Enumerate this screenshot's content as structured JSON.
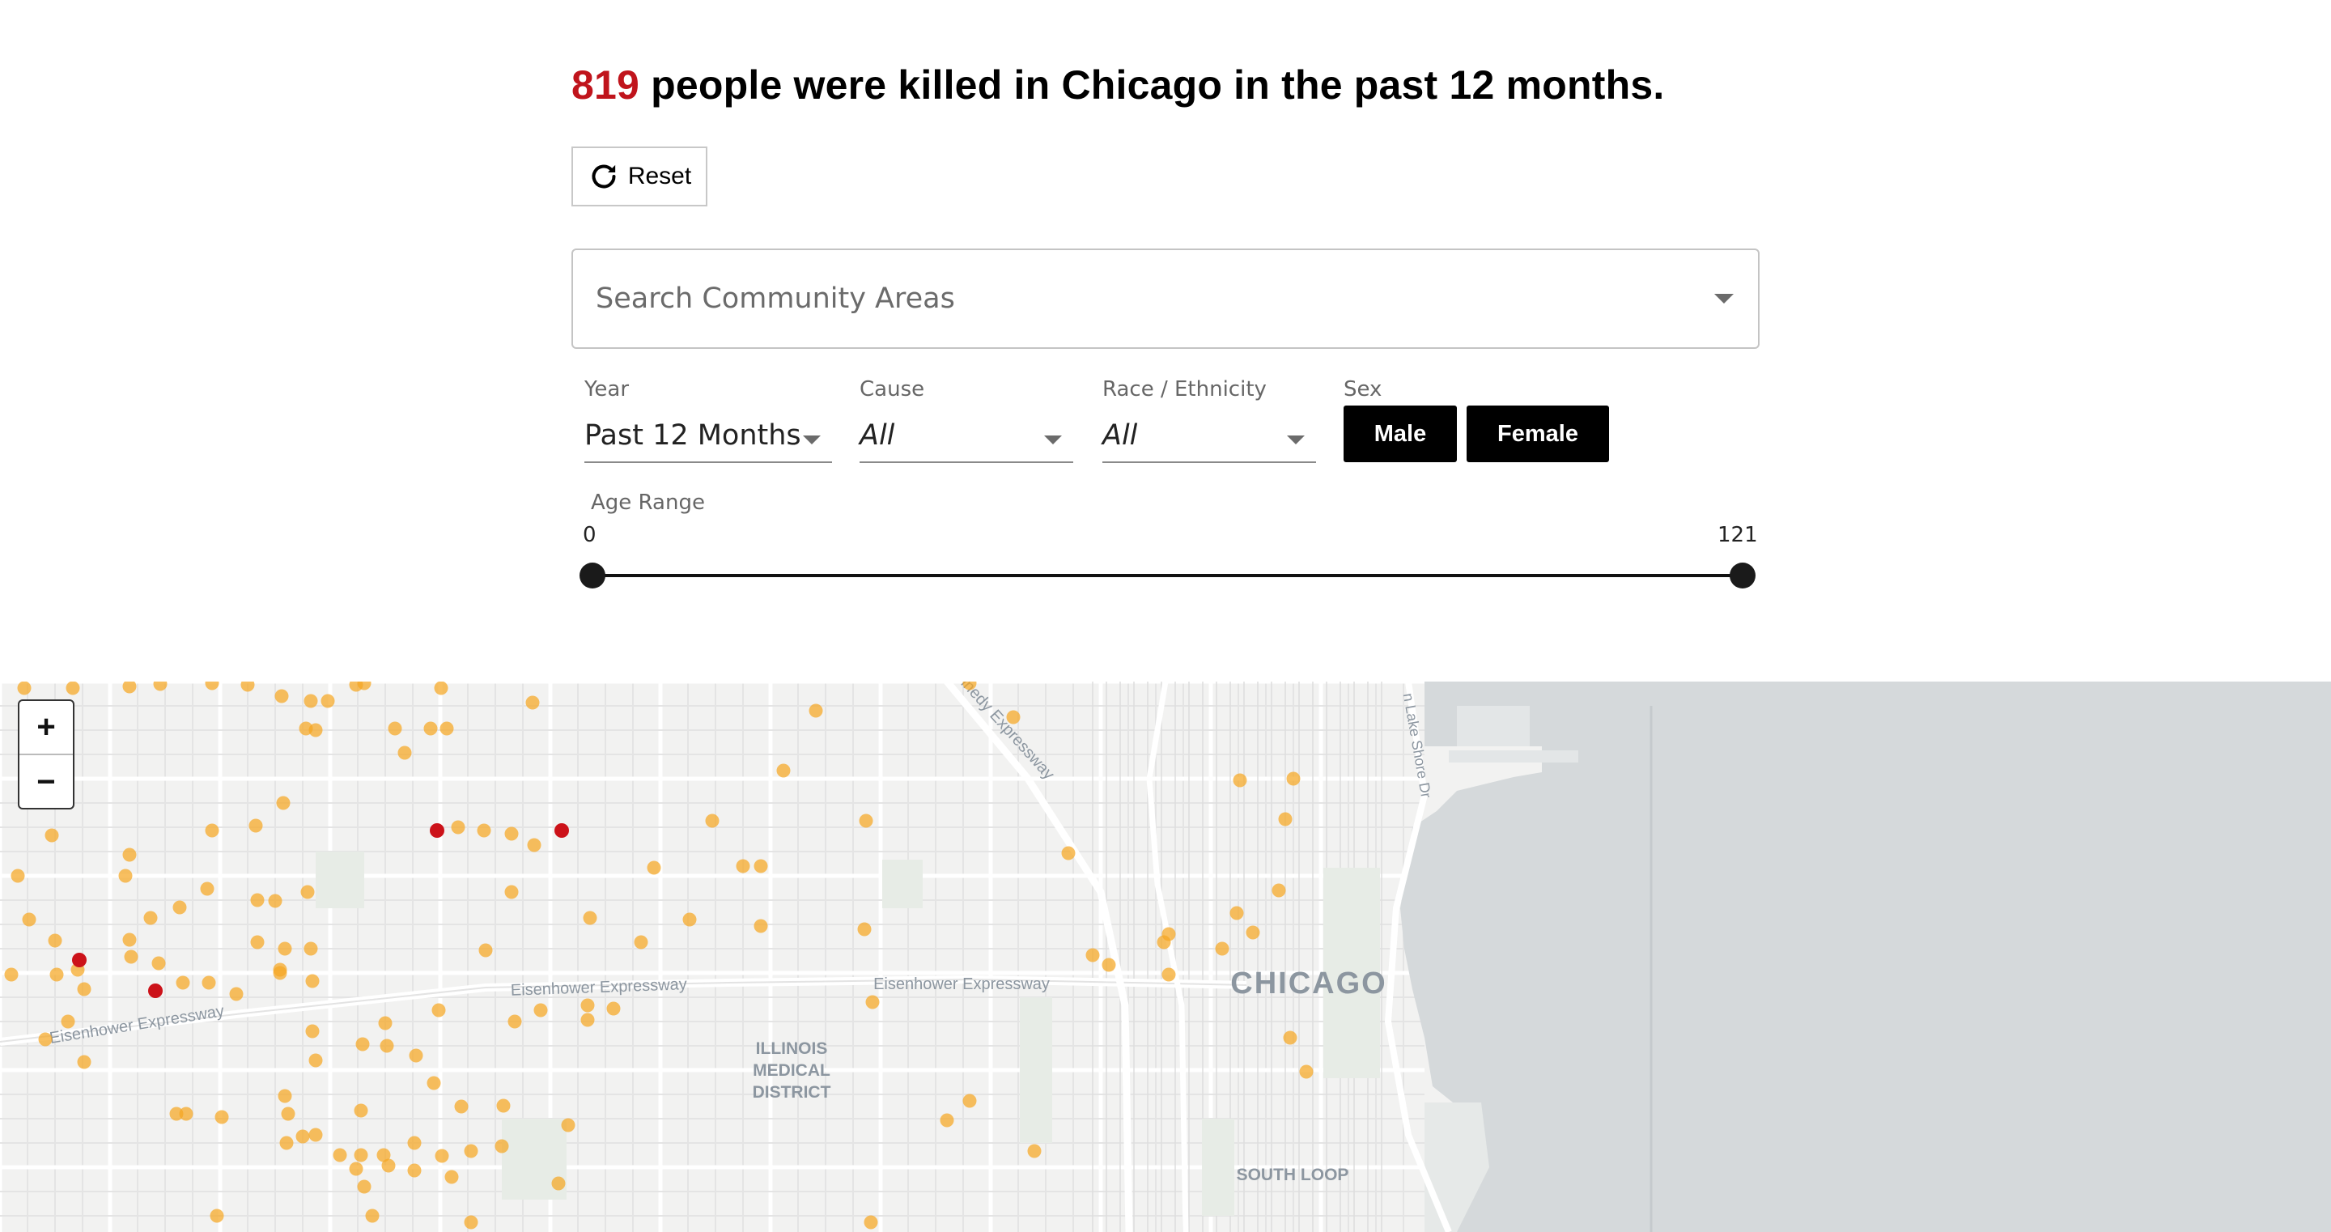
{
  "headline": {
    "count": "819",
    "text": " people were killed in Chicago in the past 12 months."
  },
  "controls": {
    "reset_label": "Reset",
    "search_placeholder": "Search Community Areas",
    "year": {
      "label": "Year",
      "value": "Past 12 Months"
    },
    "cause": {
      "label": "Cause",
      "value": "All"
    },
    "race": {
      "label": "Race / Ethnicity",
      "value": "All"
    },
    "sex": {
      "label": "Sex",
      "options": [
        "Male",
        "Female"
      ]
    },
    "age": {
      "label": "Age Range",
      "min": "0",
      "max": "121"
    }
  },
  "map": {
    "labels": {
      "city": "CHICAGO",
      "district": [
        "ILLINOIS",
        "MEDICAL",
        "DISTRICT"
      ],
      "south_loop": "SOUTH LOOP",
      "expressway_1": "Eisenhower Expressway",
      "expressway_2": "Eisenhower Expressway",
      "expressway_3": "Eisenhower Expressway",
      "kennedy": "nnedy Expressway",
      "lake_shore": "n Lake Shore Dr"
    },
    "zoom_in": "+",
    "zoom_out": "−",
    "colors": {
      "land": "#f2f2f1",
      "water": "#d4d8da",
      "highlight_dot": "#cc1219",
      "dot": "#f5a623"
    }
  }
}
